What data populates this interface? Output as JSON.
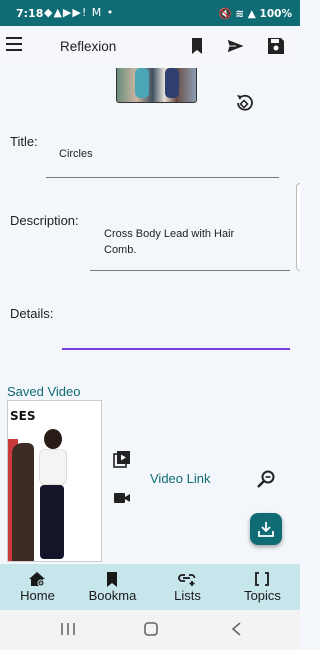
{
  "status_bar": {
    "time": "7:18",
    "notification_icons": "◆▲▶▶! M •",
    "right_icons": "🔇 ≋ ▲",
    "battery": "100%",
    "background": "#0f6b74"
  },
  "app_bar": {
    "title": "Reflexion",
    "icons": [
      "menu-icon",
      "bookmark-icon",
      "send-icon",
      "save-icon"
    ]
  },
  "form": {
    "title_label": "Title:",
    "title_value": "Circles",
    "description_label": "Description:",
    "description_value": "Cross Body Lead with Hair Comb.",
    "details_label": "Details:",
    "details_value": ""
  },
  "saved_video": {
    "heading": "Saved Video",
    "thumbnail_text": "SES",
    "link_label": "Video Link",
    "icons": [
      "video-library-icon",
      "videocam-icon",
      "zoom-out-icon",
      "download-icon"
    ]
  },
  "bottom_nav": {
    "items": [
      {
        "label": "Home",
        "icon": "home-icon"
      },
      {
        "label": "Bookma",
        "icon": "bookmark-icon"
      },
      {
        "label": "Lists",
        "icon": "link-add-icon"
      },
      {
        "label": "Topics",
        "icon": "brackets-icon"
      }
    ],
    "background": "#c6e6ec"
  },
  "colors": {
    "accent": "#0f6b74",
    "focus_underline": "#7a3fe0"
  }
}
